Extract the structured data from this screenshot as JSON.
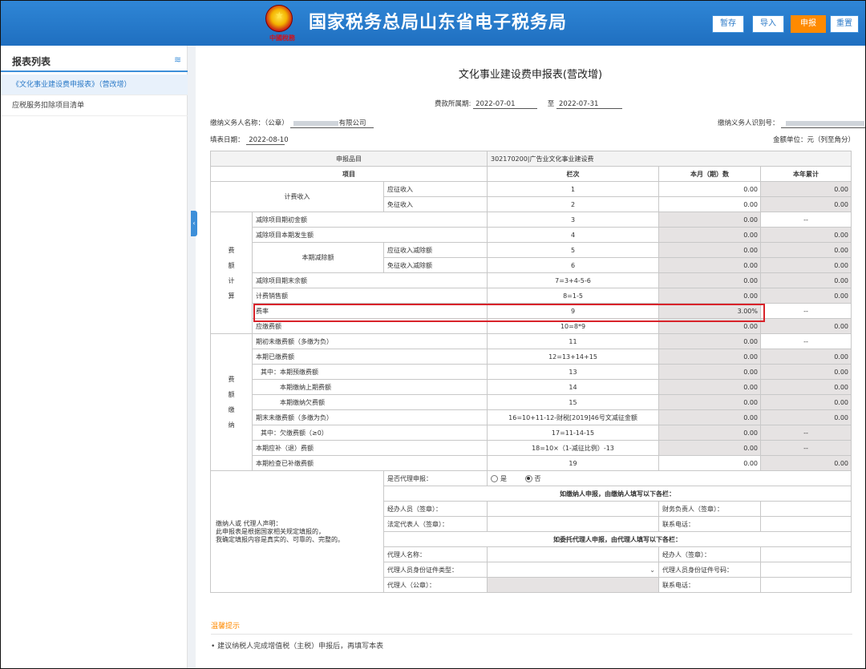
{
  "header": {
    "emblem_script": "中國稅務",
    "title": "国家税务总局山东省电子税务局",
    "buttons": {
      "save": "暂存",
      "import": "导入",
      "submit": "申报",
      "reset": "重置"
    },
    "accent_color": "#2f86d6",
    "submit_color": "#ff8a00"
  },
  "sidebar": {
    "title": "报表列表",
    "icon": "layers-icon",
    "items": [
      {
        "label": "《文化事业建设费申报表》（营改增）"
      },
      {
        "label": "应税服务扣除项目清单"
      }
    ]
  },
  "form": {
    "title": "文化事业建设费申报表(营改增)",
    "period_label": "费款所属期:",
    "period_start": "2022-07-01",
    "period_to": "至",
    "period_end": "2022-07-31",
    "payer_name_label": "缴纳义务人名称：（公章）",
    "payer_name_suffix": "有限公司",
    "payer_id_label": "缴纳义务人识别号：",
    "fill_date_label": "填表日期：",
    "fill_date": "2022-08-10",
    "unit_label": "金额单位：元（列至角分）",
    "subject_label": "申报品目",
    "subject_value": "302170200|广告业文化事业建设费",
    "col_headers": {
      "item": "项目",
      "line": "栏次",
      "current": "本月（期）数",
      "ytd": "本年累计"
    },
    "income": {
      "group": "计费收入",
      "rows": [
        {
          "label": "应征收入",
          "line": "1",
          "current": "0.00",
          "ytd": "0.00"
        },
        {
          "label": "免征收入",
          "line": "2",
          "current": "0.00",
          "ytd": "0.00"
        }
      ]
    },
    "calc": {
      "group_chars": [
        "费",
        "额",
        "计",
        "算"
      ],
      "sub_group": "本期减除额",
      "rows": [
        {
          "label": "减除项目期初金额",
          "line": "3",
          "current": "0.00",
          "ytd": "--"
        },
        {
          "label": "减除项目本期发生额",
          "line": "4",
          "current": "0.00",
          "ytd": "0.00"
        },
        {
          "label": "应征收入减除额",
          "line": "5",
          "current": "0.00",
          "ytd": "0.00"
        },
        {
          "label": "免征收入减除额",
          "line": "6",
          "current": "0.00",
          "ytd": "0.00"
        },
        {
          "label": "减除项目期末余额",
          "line": "7=3+4-5-6",
          "current": "0.00",
          "ytd": "0.00"
        },
        {
          "label": "计费销售额",
          "line": "8=1-5",
          "current": "0.00",
          "ytd": "0.00"
        },
        {
          "label": "费率",
          "line": "9",
          "current": "3.00%",
          "ytd": "--"
        },
        {
          "label": "应缴费额",
          "line": "10=8*9",
          "current": "0.00",
          "ytd": "0.00"
        }
      ]
    },
    "pay": {
      "group_chars": [
        "费",
        "额",
        "缴",
        "纳"
      ],
      "rows": [
        {
          "label": "期初未缴费额（多缴为负）",
          "line": "11",
          "current": "0.00",
          "ytd": "--"
        },
        {
          "label": "本期已缴费额",
          "line": "12=13+14+15",
          "current": "0.00",
          "ytd": "0.00"
        },
        {
          "label": "其中：本期预缴费额",
          "line": "13",
          "current": "0.00",
          "ytd": "0.00"
        },
        {
          "label": "本期缴纳上期费额",
          "line": "14",
          "current": "0.00",
          "ytd": "0.00"
        },
        {
          "label": "本期缴纳欠费额",
          "line": "15",
          "current": "0.00",
          "ytd": "0.00"
        },
        {
          "label": "期末未缴费额（多缴为负）",
          "line": "16=10+11-12-财税[2019]46号文减征金额",
          "current": "0.00",
          "ytd": "0.00"
        },
        {
          "label": "其中：欠缴费额（≥0）",
          "line": "17=11-14-15",
          "current": "0.00",
          "ytd": "--"
        },
        {
          "label": "本期应补（退）费额",
          "line": "18=10×（1-减征比例）-13",
          "current": "0.00",
          "ytd": "--"
        },
        {
          "label": "本期检查已补缴费额",
          "line": "19",
          "current": "0.00",
          "ytd": "0.00"
        }
      ]
    },
    "declaration": {
      "text_1": "缴纳人或 代理人声明：",
      "text_2": "此申报表是根据国家相关规定填报的，",
      "text_3": "我确定填报内容是真实的、可靠的、完整的。",
      "agent_q": "是否代理申报：",
      "opt_yes": "是",
      "opt_no": "否",
      "self_header": "如缴纳人申报，由缴纳人填写以下各栏：",
      "handler": "经办人员（签章）：",
      "finance": "财务负责人（签章）：",
      "legal": "法定代表人（签章）：",
      "phone": "联系电话：",
      "agent_header": "如委托代理人申报，由代理人填写以下各栏：",
      "agent_name": "代理人名称：",
      "agent_handler": "经办人（签章）：",
      "agent_id_type": "代理人员身份证件类型：",
      "agent_id_no": "代理人员身份证件号码：",
      "agent_seal": "代理人（公章）：",
      "agent_phone": "联系电话："
    }
  },
  "tips": {
    "title": "温馨提示",
    "text": "• 建议纳税人完成增值税（主税）申报后，再填写本表"
  }
}
